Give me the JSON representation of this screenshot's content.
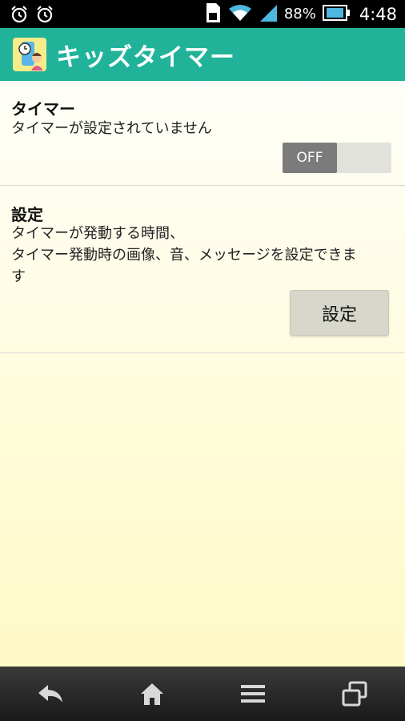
{
  "status_bar": {
    "icons_left": [
      "alarm-icon",
      "alarm-icon"
    ],
    "icons_right": [
      "sim-icon",
      "wifi-icon",
      "signal-icon",
      "battery-icon"
    ],
    "battery_percent": "88%",
    "time": "4:48"
  },
  "action_bar": {
    "app_icon": "kids-timer-app-icon",
    "title": "キッズタイマー"
  },
  "timer_section": {
    "title": "タイマー",
    "description": "タイマーが設定されていません",
    "toggle_label": "OFF",
    "toggle_on": false
  },
  "settings_section": {
    "title": "設定",
    "description_line1": "タイマーが発動する時間、",
    "description_line2": "タイマー発動時の画像、音、メッセージを設定できま",
    "description_line3": "す",
    "button_label": "設定"
  },
  "nav_bar": {
    "buttons": [
      "back-icon",
      "home-icon",
      "menu-icon",
      "recent-apps-icon"
    ]
  },
  "colors": {
    "action_bar": "#20b39a",
    "toggle_off": "#7b7b7b"
  }
}
